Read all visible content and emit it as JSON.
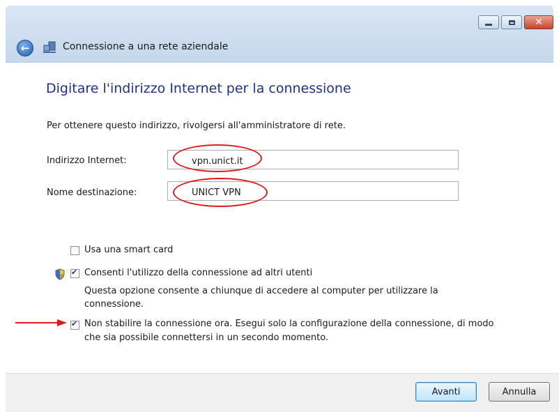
{
  "window": {
    "title": "Connessione a una rete aziendale",
    "controls": {
      "minimize": "minimize",
      "maximize": "maximize",
      "close": "close"
    }
  },
  "page": {
    "heading": "Digitare l'indirizzo Internet per la connessione",
    "intro": "Per ottenere questo indirizzo, rivolgersi all'amministratore di rete."
  },
  "form": {
    "internet_address": {
      "label": "Indirizzo Internet:",
      "value": "vpn.unict.it"
    },
    "destination_name": {
      "label": "Nome destinazione:",
      "value": "UNICT VPN"
    }
  },
  "options": {
    "smart_card": {
      "label": "Usa una smart card",
      "checked": false
    },
    "allow_others": {
      "label": "Consenti l'utilizzo della connessione ad altri utenti",
      "description_line1": "Questa opzione consente a chiunque di accedere al computer per utilizzare la",
      "description_line2": "connessione.",
      "checked": true
    },
    "dont_connect": {
      "label_line1": "Non stabilire la connessione ora. Esegui solo la configurazione della connessione, di modo",
      "label_line2": "che sia possibile connettersi in un secondo momento.",
      "checked": true
    }
  },
  "buttons": {
    "next": "Avanti",
    "cancel": "Annulla"
  },
  "colors": {
    "heading": "#1e3287",
    "annotation": "#e01b1b"
  },
  "icons": {
    "back": "back-arrow-icon",
    "app": "network-connection-icon",
    "uac": "uac-shield-icon"
  }
}
